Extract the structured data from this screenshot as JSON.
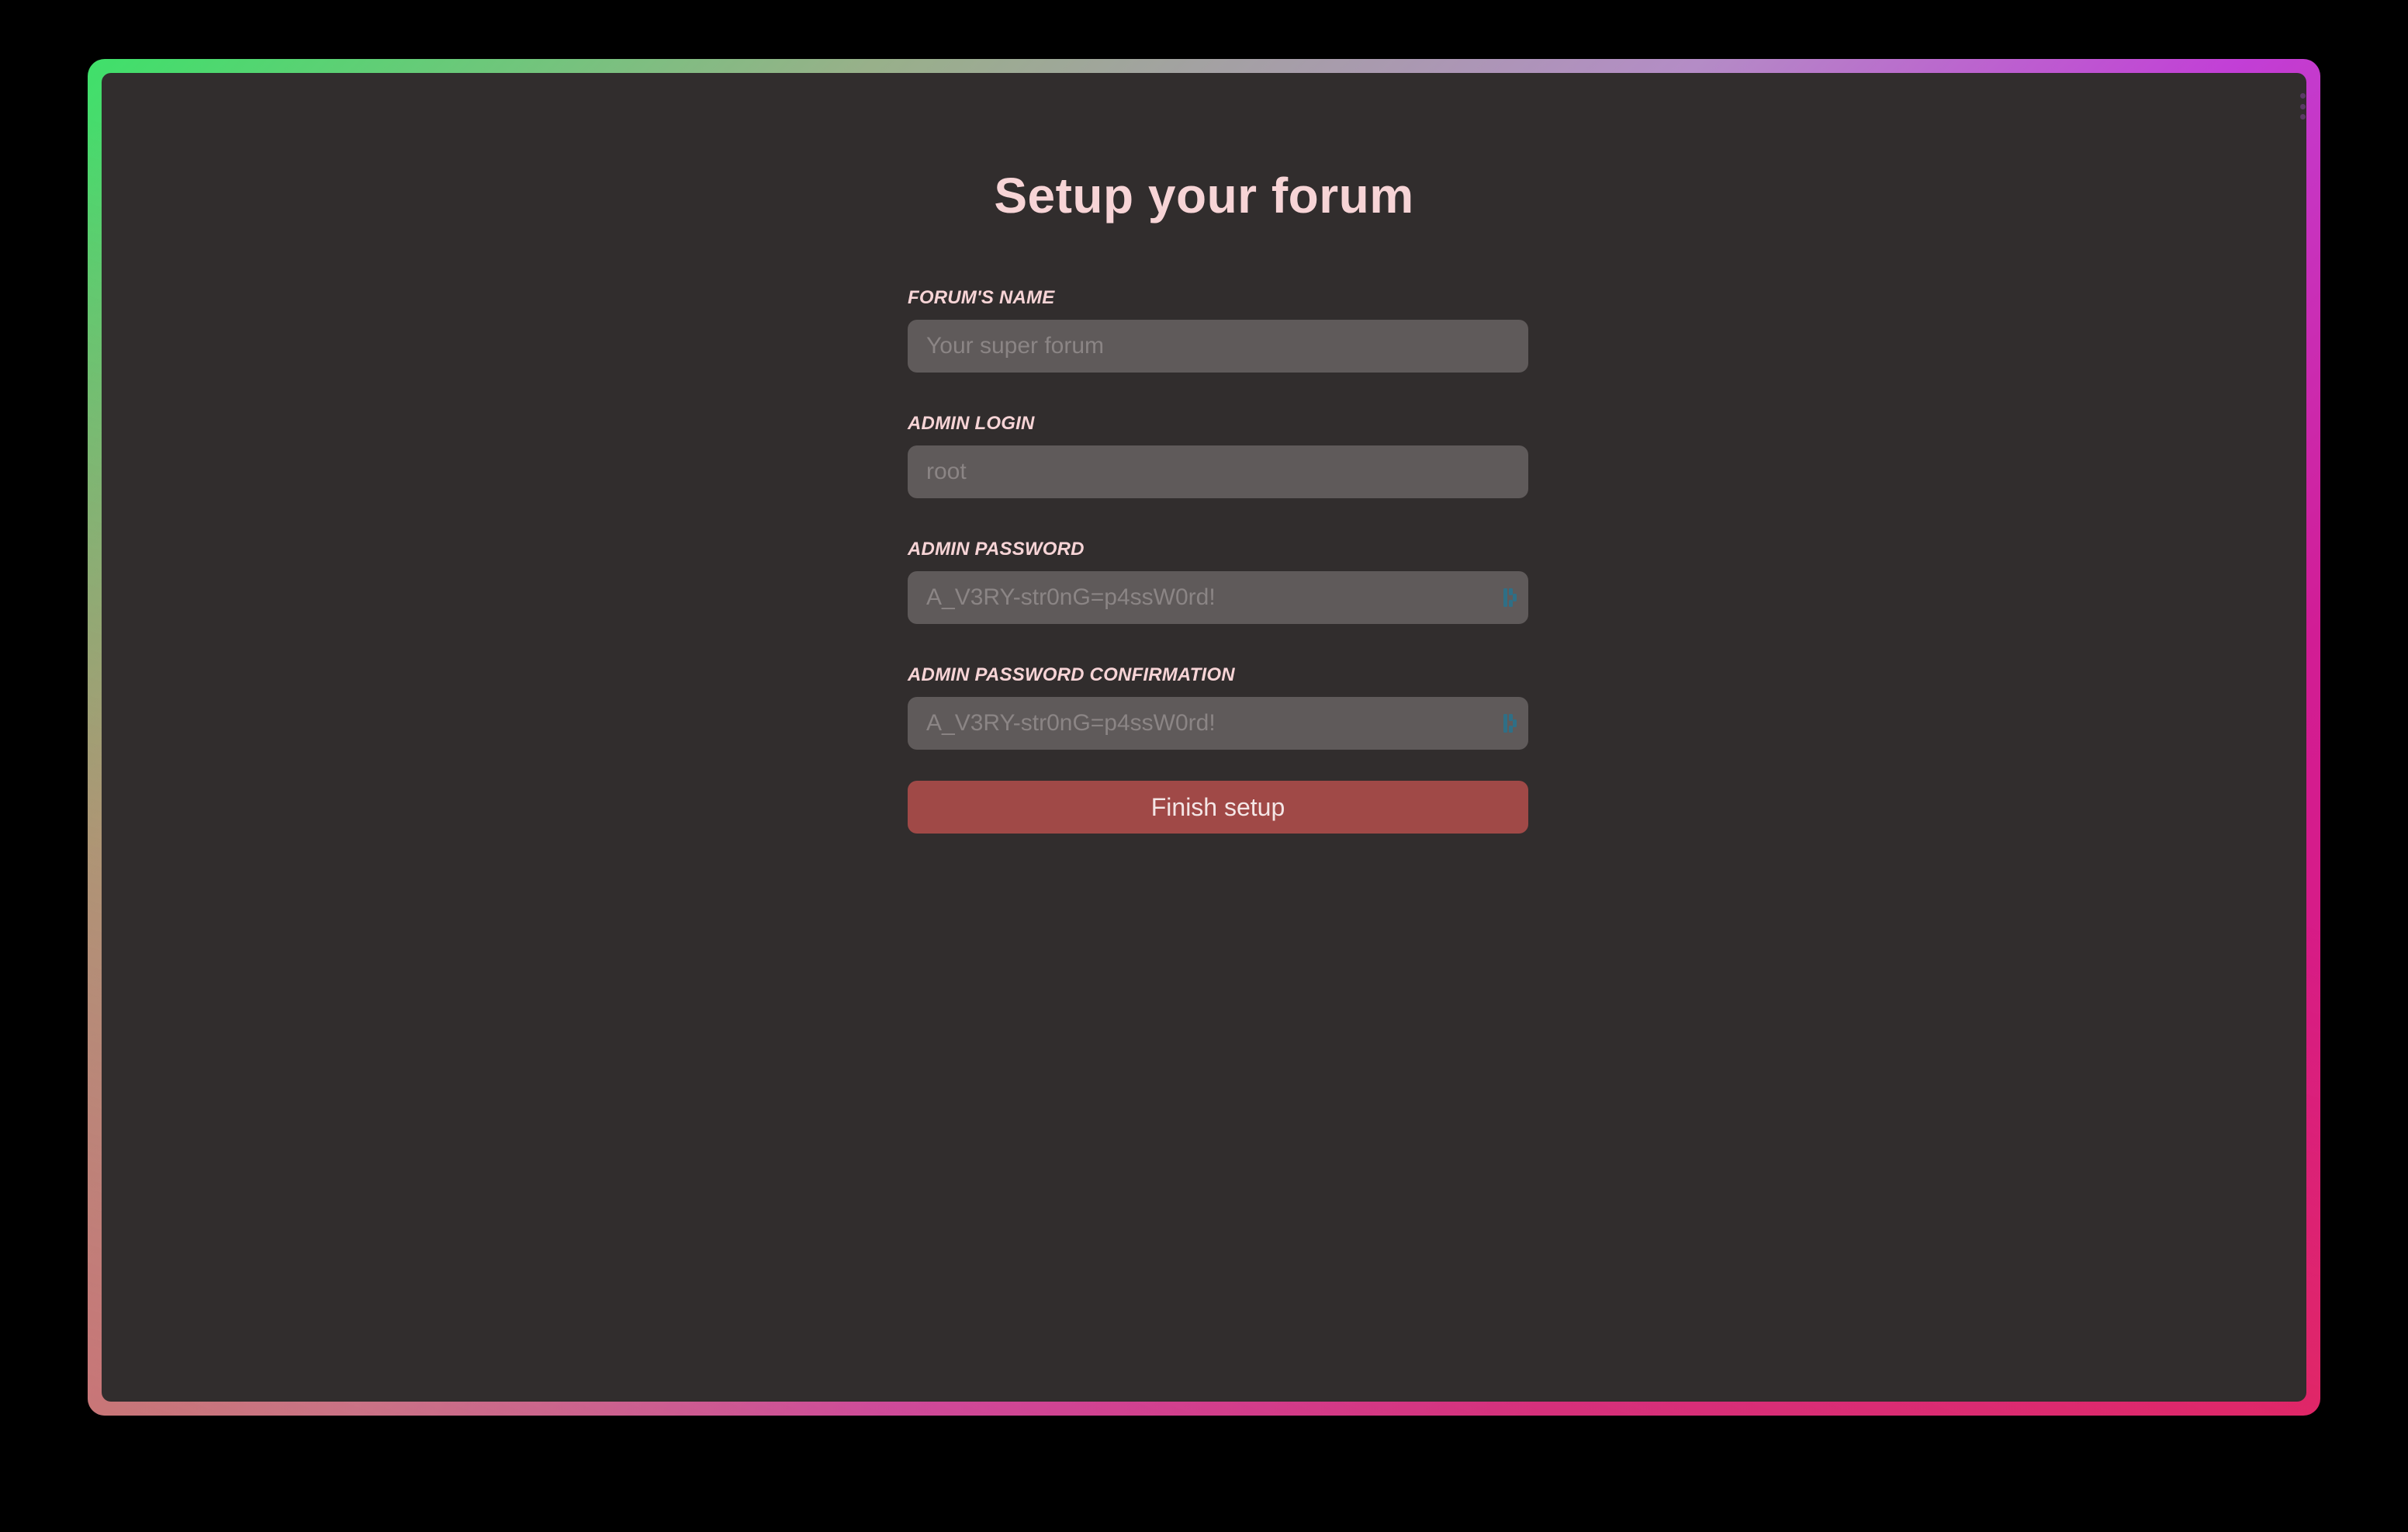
{
  "page": {
    "title": "Setup your forum"
  },
  "form": {
    "fields": [
      {
        "label": "FORUM'S NAME",
        "placeholder": "Your super forum",
        "value": ""
      },
      {
        "label": "ADMIN LOGIN",
        "placeholder": "root",
        "value": ""
      },
      {
        "label": "ADMIN PASSWORD",
        "placeholder": "A_V3RY-str0nG=p4ssW0rd!",
        "value": "",
        "icon": "password-manager-icon"
      },
      {
        "label": "ADMIN PASSWORD CONFIRMATION",
        "placeholder": "A_V3RY-str0nG=p4ssW0rd!",
        "value": "",
        "icon": "password-manager-icon"
      }
    ],
    "submit_label": "Finish setup"
  },
  "colors": {
    "background": "#312d2d",
    "text": "#f7d4d6",
    "input_background": "#5f5a5a",
    "button": "#a04947",
    "frame_gradient": [
      "#3fe06a",
      "#b48cc6",
      "#c23fd6",
      "#e01a70"
    ]
  }
}
